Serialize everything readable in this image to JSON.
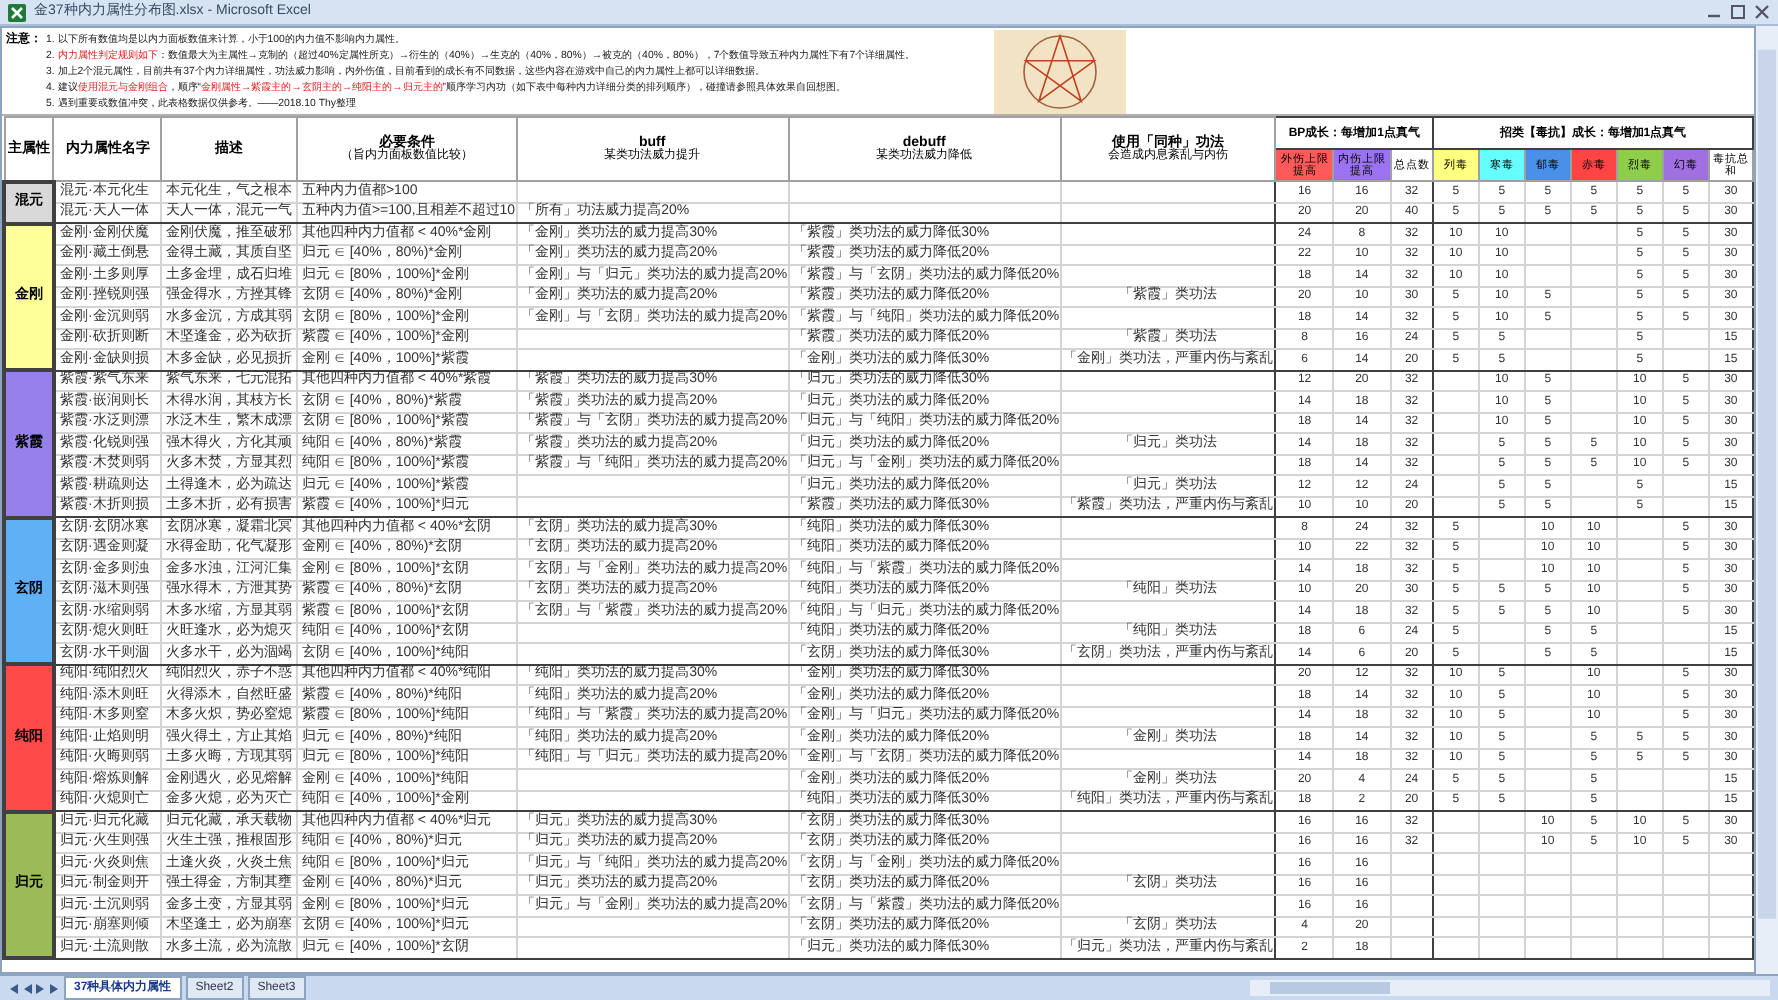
{
  "window": {
    "title": "金37种内力属性分布图.xlsx - Microsoft Excel"
  },
  "notes": {
    "label": "注意：",
    "items": [
      [
        {
          "text": "1. 以下所有数值均是以内力面板数值来计算，小于100的内力值不影响内力属性。",
          "highlight": false
        }
      ],
      [
        {
          "text": "2. ",
          "highlight": false
        },
        {
          "text": "内力属性判定规则如下",
          "highlight": true
        },
        {
          "text": "：数值最大为主属性→克制的（超过40%定属性所克）→衍生的（40%）→生克的（40%，80%）→被克的（40%，80%），7个数值导致五种内力属性下有7个详细属性。",
          "highlight": false
        }
      ],
      [
        {
          "text": "3. 加上2个混元属性，目前共有37个内力详细属性，功法威力影响，内外伤值，目前看到的成长有不同数据，这些内容在游戏中自己的内力属性上都可以详细数据。",
          "highlight": false
        }
      ],
      [
        {
          "text": "4. 建议",
          "highlight": false
        },
        {
          "text": "使用混元与金刚组合",
          "highlight": true
        },
        {
          "text": "，顺序“",
          "highlight": false
        },
        {
          "text": "金刚属性→紫霞主的→玄阴主的→纯阳主的→归元主的",
          "highlight": true
        },
        {
          "text": "”顺序学习内功（如下表中每种内力详细分类的排列顺序），碰撞请参照具体效果自回想图。",
          "highlight": false
        }
      ],
      [
        {
          "text": "5. 遇到重要或数值冲突，此表格数据仅供参考。——2018.10 Thy整理",
          "highlight": false
        }
      ]
    ]
  },
  "table": {
    "columns": [
      {
        "title": "主属性"
      },
      {
        "title": "内力属性名字"
      },
      {
        "title": "描述"
      },
      {
        "title": "必要条件",
        "subtitle": "（旨内力面板数值比较）"
      },
      {
        "title": "buff",
        "subtitle": "某类功法威力提升"
      },
      {
        "title": "debuff",
        "subtitle": "某类功法威力降低"
      },
      {
        "title": "使用「同种」功法",
        "subtitle": "会造成内息紊乱与内伤"
      }
    ],
    "column_groups": [
      {
        "title": "BP成长：每增加1点真气",
        "columns": [
          {
            "label": "外伤上限提高",
            "color": "#ff5a5a"
          },
          {
            "label": "内伤上限提高",
            "color": "#9b72f0"
          },
          {
            "label": "总点数",
            "color": "#ffffff"
          }
        ]
      },
      {
        "title": "招类【毒抗】成长：每增加1点真气",
        "columns": [
          {
            "label": "列毒",
            "color": "#ffff80"
          },
          {
            "label": "寒毒",
            "color": "#66ffff"
          },
          {
            "label": "郁毒",
            "color": "#4a90e8"
          },
          {
            "label": "赤毒",
            "color": "#ff4444"
          },
          {
            "label": "烈毒",
            "color": "#8fce4a"
          },
          {
            "label": "幻毒",
            "color": "#a070e0"
          },
          {
            "label": "毒抗总和",
            "color": "#ffffff"
          }
        ]
      }
    ],
    "groups": [
      {
        "label": "混元",
        "color": "#d9d9d9",
        "rows": [
          {
            "name": "混元·本元化生",
            "description": "本元化生，气之根本",
            "condition": "五种内力值都>100",
            "values": {
              "outer": "16",
              "inner": "16",
              "total": "32",
              "poison_1": "5",
              "poison_2": "5",
              "poison_3": "5",
              "poison_4": "5",
              "poison_5": "5",
              "poison_6": "5",
              "poison_total": "30"
            }
          },
          {
            "name": "混元·天人一体",
            "description": "天人一体，混元一气",
            "condition": "五种内力值>=100,且相差不超过10",
            "buff": "「所有」功法威力提高20%",
            "values": {
              "outer": "20",
              "inner": "20",
              "total": "40",
              "poison_1": "5",
              "poison_2": "5",
              "poison_3": "5",
              "poison_4": "5",
              "poison_5": "5",
              "poison_6": "5",
              "poison_total": "30"
            }
          }
        ]
      },
      {
        "label": "金刚",
        "color": "#ffff99",
        "rows": [
          {
            "name": "金刚·金刚伏魔",
            "description": "金刚伏魔，推至破邪",
            "condition": "其他四种内力值都 < 40%*金刚",
            "buff": "「金刚」类功法的威力提高30%",
            "debuff": "「紫霞」类功法的威力降低30%",
            "values": {
              "outer": "24",
              "inner": "8",
              "total": "32",
              "poison_1": "10",
              "poison_2": "10",
              "poison_5": "5",
              "poison_6": "5",
              "poison_total": "30"
            }
          },
          {
            "name": "金刚·藏土倒悬",
            "description": "金得土藏，其质自坚",
            "condition": "归元 ∈ [40%，80%)*金刚",
            "buff": "「金刚」类功法的威力提高20%",
            "debuff": "「紫霞」类功法的威力降低20%",
            "values": {
              "outer": "22",
              "inner": "10",
              "total": "32",
              "poison_1": "10",
              "poison_2": "10",
              "poison_5": "5",
              "poison_6": "5",
              "poison_total": "30"
            }
          },
          {
            "name": "金刚·土多则厚",
            "description": "土多金埋，成石归堆",
            "condition": "归元 ∈ [80%，100%]*金刚",
            "buff": "「金刚」与「归元」类功法的威力提高20%",
            "debuff": "「紫霞」与「玄阴」类功法的威力降低20%",
            "values": {
              "outer": "18",
              "inner": "14",
              "total": "32",
              "poison_1": "10",
              "poison_2": "10",
              "poison_5": "5",
              "poison_6": "5",
              "poison_total": "30"
            }
          },
          {
            "name": "金刚·挫锐则强",
            "description": "强金得水，方挫其锋",
            "condition": "玄阴 ∈ [40%，80%)*金刚",
            "buff": "「金刚」类功法的威力提高20%",
            "debuff": "「紫霞」类功法的威力降低20%",
            "same_type_use": "「紫霞」类功法",
            "values": {
              "outer": "20",
              "inner": "10",
              "total": "30",
              "poison_1": "5",
              "poison_2": "10",
              "poison_3": "5",
              "poison_5": "5",
              "poison_6": "5",
              "poison_total": "30"
            }
          },
          {
            "name": "金刚·金沉则弱",
            "description": "水多金沉，方成其弱",
            "condition": "玄阴 ∈ [80%，100%]*金刚",
            "buff": "「金刚」与「玄阴」类功法的威力提高20%",
            "debuff": "「紫霞」与「纯阳」类功法的威力降低20%",
            "values": {
              "outer": "18",
              "inner": "14",
              "total": "32",
              "poison_1": "5",
              "poison_2": "10",
              "poison_3": "5",
              "poison_5": "5",
              "poison_6": "5",
              "poison_total": "30"
            }
          },
          {
            "name": "金刚·砍折则断",
            "description": "木坚逢金，必为砍折",
            "condition": "紫霞 ∈ [40%，100%]*金刚",
            "debuff": "「紫霞」类功法的威力降低20%",
            "same_type_use": "「紫霞」类功法",
            "values": {
              "outer": "8",
              "inner": "16",
              "total": "24",
              "poison_1": "5",
              "poison_2": "5",
              "poison_5": "5",
              "poison_total": "15"
            }
          },
          {
            "name": "金刚·金缺则损",
            "description": "木多金缺，必见损折",
            "condition": "金刚 ∈ [40%，100%]*紫霞",
            "debuff": "「金刚」类功法的威力降低30%",
            "same_type_use": "「金刚」类功法，严重内伤与紊乱",
            "values": {
              "outer": "6",
              "inner": "14",
              "total": "20",
              "poison_1": "5",
              "poison_2": "5",
              "poison_5": "5",
              "poison_total": "15"
            }
          }
        ]
      },
      {
        "label": "紫霞",
        "color": "#9580ec",
        "rows": [
          {
            "name": "紫霞·紫气东来",
            "description": "紫气东来，七元混拓",
            "condition": "其他四种内力值都 < 40%*紫霞",
            "buff": "「紫霞」类功法的威力提高30%",
            "debuff": "「归元」类功法的威力降低30%",
            "values": {
              "outer": "12",
              "inner": "20",
              "total": "32",
              "poison_2": "10",
              "poison_3": "5",
              "poison_5": "10",
              "poison_6": "5",
              "poison_total": "30"
            }
          },
          {
            "name": "紫霞·嵌润则长",
            "description": "木得水润，其枝方长",
            "condition": "玄阴 ∈ [40%，80%)*紫霞",
            "buff": "「紫霞」类功法的威力提高20%",
            "debuff": "「归元」类功法的威力降低20%",
            "values": {
              "outer": "14",
              "inner": "18",
              "total": "32",
              "poison_2": "10",
              "poison_3": "5",
              "poison_5": "10",
              "poison_6": "5",
              "poison_total": "30"
            }
          },
          {
            "name": "紫霞·水泛则漂",
            "description": "水泛木生，繁木成漂",
            "condition": "玄阴 ∈ [80%，100%]*紫霞",
            "buff": "「紫霞」与「玄阴」类功法的威力提高20%",
            "debuff": "「归元」与「纯阳」类功法的威力降低20%",
            "values": {
              "outer": "18",
              "inner": "14",
              "total": "32",
              "poison_2": "10",
              "poison_3": "5",
              "poison_5": "10",
              "poison_6": "5",
              "poison_total": "30"
            }
          },
          {
            "name": "紫霞·化锐则强",
            "description": "强木得火，方化其顽",
            "condition": "纯阳 ∈ [40%，80%)*紫霞",
            "buff": "「紫霞」类功法的威力提高20%",
            "debuff": "「归元」类功法的威力降低20%",
            "same_type_use": "「归元」类功法",
            "values": {
              "outer": "14",
              "inner": "18",
              "total": "32",
              "poison_2": "5",
              "poison_3": "5",
              "poison_4": "5",
              "poison_5": "10",
              "poison_6": "5",
              "poison_total": "30"
            }
          },
          {
            "name": "紫霞·木焚则弱",
            "description": "火多木焚，方显其烈",
            "condition": "纯阳 ∈ [80%，100%]*紫霞",
            "buff": "「紫霞」与「纯阳」类功法的威力提高20%",
            "debuff": "「归元」与「金刚」类功法的威力降低20%",
            "values": {
              "outer": "18",
              "inner": "14",
              "total": "32",
              "poison_2": "5",
              "poison_3": "5",
              "poison_4": "5",
              "poison_5": "10",
              "poison_6": "5",
              "poison_total": "30"
            }
          },
          {
            "name": "紫霞·耕疏则达",
            "description": "土得逢木，必为疏达",
            "condition": "归元 ∈ [40%，100%]*紫霞",
            "debuff": "「归元」类功法的威力降低20%",
            "same_type_use": "「归元」类功法",
            "values": {
              "outer": "12",
              "inner": "12",
              "total": "24",
              "poison_2": "5",
              "poison_3": "5",
              "poison_5": "5",
              "poison_total": "15"
            }
          },
          {
            "name": "紫霞·木折则损",
            "description": "土多木折，必有损害",
            "condition": "紫霞 ∈ [40%，100%]*归元",
            "debuff": "「紫霞」类功法的威力降低30%",
            "same_type_use": "「紫霞」类功法，严重内伤与紊乱",
            "values": {
              "outer": "10",
              "inner": "10",
              "total": "20",
              "poison_2": "5",
              "poison_3": "5",
              "poison_5": "5",
              "poison_total": "15"
            }
          }
        ]
      },
      {
        "label": "玄阴",
        "color": "#5fb0f5",
        "rows": [
          {
            "name": "玄阴·玄阴冰寒",
            "description": "玄阴冰寒，凝霜北冥",
            "condition": "其他四种内力值都 < 40%*玄阴",
            "buff": "「玄阴」类功法的威力提高30%",
            "debuff": "「纯阳」类功法的威力降低30%",
            "values": {
              "outer": "8",
              "inner": "24",
              "total": "32",
              "poison_1": "5",
              "poison_3": "10",
              "poison_4": "10",
              "poison_6": "5",
              "poison_total": "30"
            }
          },
          {
            "name": "玄阴·遇金则凝",
            "description": "水得金助，化气凝形",
            "condition": "金刚 ∈ [40%，80%)*玄阴",
            "buff": "「玄阴」类功法的威力提高20%",
            "debuff": "「纯阳」类功法的威力降低20%",
            "values": {
              "outer": "10",
              "inner": "22",
              "total": "32",
              "poison_1": "5",
              "poison_3": "10",
              "poison_4": "10",
              "poison_6": "5",
              "poison_total": "30"
            }
          },
          {
            "name": "玄阴·金多则浊",
            "description": "金多水浊，江河汇集",
            "condition": "金刚 ∈ [80%，100%]*玄阴",
            "buff": "「玄阴」与「金刚」类功法的威力提高20%",
            "debuff": "「纯阳」与「紫霞」类功法的威力降低20%",
            "values": {
              "outer": "14",
              "inner": "18",
              "total": "32",
              "poison_1": "5",
              "poison_3": "10",
              "poison_4": "10",
              "poison_6": "5",
              "poison_total": "30"
            }
          },
          {
            "name": "玄阴·滋木则强",
            "description": "强水得木，方泄其势",
            "condition": "紫霞 ∈ [40%，80%)*玄阴",
            "buff": "「玄阴」类功法的威力提高20%",
            "debuff": "「纯阳」类功法的威力降低20%",
            "same_type_use": "「纯阳」类功法",
            "values": {
              "outer": "10",
              "inner": "20",
              "total": "30",
              "poison_1": "5",
              "poison_2": "5",
              "poison_3": "5",
              "poison_4": "10",
              "poison_6": "5",
              "poison_total": "30"
            }
          },
          {
            "name": "玄阴·水缩则弱",
            "description": "木多水缩，方显其弱",
            "condition": "紫霞 ∈ [80%，100%]*玄阴",
            "buff": "「玄阴」与「紫霞」类功法的威力提高20%",
            "debuff": "「纯阳」与「归元」类功法的威力降低20%",
            "values": {
              "outer": "14",
              "inner": "18",
              "total": "32",
              "poison_1": "5",
              "poison_2": "5",
              "poison_3": "5",
              "poison_4": "10",
              "poison_6": "5",
              "poison_total": "30"
            }
          },
          {
            "name": "玄阴·熄火则旺",
            "description": "火旺逢水，必为熄灭",
            "condition": "纯阳 ∈ [40%，100%]*玄阴",
            "debuff": "「纯阳」类功法的威力降低20%",
            "same_type_use": "「纯阳」类功法",
            "values": {
              "outer": "18",
              "inner": "6",
              "total": "24",
              "poison_1": "5",
              "poison_3": "5",
              "poison_4": "5",
              "poison_total": "15"
            }
          },
          {
            "name": "玄阴·水干则涸",
            "description": "火多水干，必为涸竭",
            "condition": "玄阴 ∈ [40%，100%]*纯阳",
            "debuff": "「玄阴」类功法的威力降低30%",
            "same_type_use": "「玄阴」类功法，严重内伤与紊乱",
            "values": {
              "outer": "14",
              "inner": "6",
              "total": "20",
              "poison_1": "5",
              "poison_3": "5",
              "poison_4": "5",
              "poison_total": "15"
            }
          }
        ]
      },
      {
        "label": "纯阳",
        "color": "#ff4a4a",
        "rows": [
          {
            "name": "纯阳·纯阳烈火",
            "description": "纯阳烈火，赤子不惑",
            "condition": "其他四种内力值都 < 40%*纯阳",
            "buff": "「纯阳」类功法的威力提高30%",
            "debuff": "「金刚」类功法的威力降低30%",
            "values": {
              "outer": "20",
              "inner": "12",
              "total": "32",
              "poison_1": "10",
              "poison_2": "5",
              "poison_4": "10",
              "poison_6": "5",
              "poison_total": "30"
            }
          },
          {
            "name": "纯阳·添木则旺",
            "description": "火得添木，自然旺盛",
            "condition": "紫霞 ∈ [40%，80%)*纯阳",
            "buff": "「纯阳」类功法的威力提高20%",
            "debuff": "「金刚」类功法的威力降低20%",
            "values": {
              "outer": "18",
              "inner": "14",
              "total": "32",
              "poison_1": "10",
              "poison_2": "5",
              "poison_4": "10",
              "poison_6": "5",
              "poison_total": "30"
            }
          },
          {
            "name": "纯阳·木多则窒",
            "description": "木多火炽，势必窒熄",
            "condition": "紫霞 ∈ [80%，100%]*纯阳",
            "buff": "「纯阳」与「紫霞」类功法的威力提高20%",
            "debuff": "「金刚」与「归元」类功法的威力降低20%",
            "values": {
              "outer": "14",
              "inner": "18",
              "total": "32",
              "poison_1": "10",
              "poison_2": "5",
              "poison_4": "10",
              "poison_6": "5",
              "poison_total": "30"
            }
          },
          {
            "name": "纯阳·止焰则明",
            "description": "强火得土，方止其焰",
            "condition": "归元 ∈ [40%，80%)*纯阳",
            "buff": "「纯阳」类功法的威力提高20%",
            "debuff": "「金刚」类功法的威力降低20%",
            "same_type_use": "「金刚」类功法",
            "values": {
              "outer": "18",
              "inner": "14",
              "total": "32",
              "poison_1": "10",
              "poison_2": "5",
              "poison_4": "5",
              "poison_5": "5",
              "poison_6": "5",
              "poison_total": "30"
            }
          },
          {
            "name": "纯阳·火晦则弱",
            "description": "土多火晦，方现其弱",
            "condition": "归元 ∈ [80%，100%]*纯阳",
            "buff": "「纯阳」与「归元」类功法的威力提高20%",
            "debuff": "「金刚」与「玄阴」类功法的威力降低20%",
            "values": {
              "outer": "14",
              "inner": "18",
              "total": "32",
              "poison_1": "10",
              "poison_2": "5",
              "poison_4": "5",
              "poison_5": "5",
              "poison_6": "5",
              "poison_total": "30"
            }
          },
          {
            "name": "纯阳·熔炼则解",
            "description": "金刚遇火，必见熔解",
            "condition": "金刚 ∈ [40%，100%]*纯阳",
            "debuff": "「金刚」类功法的威力降低20%",
            "same_type_use": "「金刚」类功法",
            "values": {
              "outer": "20",
              "inner": "4",
              "total": "24",
              "poison_1": "5",
              "poison_2": "5",
              "poison_4": "5",
              "poison_total": "15"
            }
          },
          {
            "name": "纯阳·火熄则亡",
            "description": "金多火熄，必为灭亡",
            "condition": "纯阳 ∈ [40%，100%]*金刚",
            "debuff": "「纯阳」类功法的威力降低30%",
            "same_type_use": "「纯阳」类功法，严重内伤与紊乱",
            "values": {
              "outer": "18",
              "inner": "2",
              "total": "20",
              "poison_1": "5",
              "poison_2": "5",
              "poison_4": "5",
              "poison_total": "15"
            }
          }
        ]
      },
      {
        "label": "归元",
        "color": "#9bbb59",
        "rows": [
          {
            "name": "归元·归元化藏",
            "description": "归元化藏，承天载物",
            "condition": "其他四种内力值都 < 40%*归元",
            "buff": "「归元」类功法的威力提高30%",
            "debuff": "「玄阴」类功法的威力降低30%",
            "values": {
              "outer": "16",
              "inner": "16",
              "total": "32",
              "poison_3": "10",
              "poison_4": "5",
              "poison_5": "10",
              "poison_6": "5",
              "poison_total": "30"
            }
          },
          {
            "name": "归元·火生则强",
            "description": "火生土强，推根固形",
            "condition": "纯阳 ∈ [40%，80%)*归元",
            "buff": "「归元」类功法的威力提高20%",
            "debuff": "「玄阴」类功法的威力降低20%",
            "values": {
              "outer": "16",
              "inner": "16",
              "total": "32",
              "poison_3": "10",
              "poison_4": "5",
              "poison_5": "10",
              "poison_6": "5",
              "poison_total": "30"
            }
          },
          {
            "name": "归元·火炎则焦",
            "description": "土逢火炎，火炎土焦",
            "condition": "纯阳 ∈ [80%，100%]*归元",
            "buff": "「归元」与「纯阳」类功法的威力提高20%",
            "debuff": "「玄阴」与「金刚」类功法的威力降低20%",
            "values": {
              "outer": "16",
              "inner": "16"
            }
          },
          {
            "name": "归元·制金则开",
            "description": "强土得金，方制其壅",
            "condition": "金刚 ∈ [40%，80%)*归元",
            "buff": "「归元」类功法的威力提高20%",
            "debuff": "「玄阴」类功法的威力降低20%",
            "same_type_use": "「玄阴」类功法",
            "values": {
              "outer": "16",
              "inner": "16"
            }
          },
          {
            "name": "归元·土沉则弱",
            "description": "金多土变，方显其弱",
            "condition": "金刚 ∈ [80%，100%]*归元",
            "buff": "「归元」与「金刚」类功法的威力提高20%",
            "debuff": "「玄阴」与「紫霞」类功法的威力降低20%",
            "values": {
              "outer": "16",
              "inner": "16"
            }
          },
          {
            "name": "归元·崩塞则倾",
            "description": "木坚逢土，必为崩塞",
            "condition": "玄阴 ∈ [40%，100%]*归元",
            "debuff": "「玄阴」类功法的威力降低20%",
            "same_type_use": "「玄阴」类功法",
            "values": {
              "outer": "4",
              "inner": "20"
            }
          },
          {
            "name": "归元·土流则散",
            "description": "水多土流，必为流散",
            "condition": "归元 ∈ [40%，100%]*玄阴",
            "debuff": "「归元」类功法的威力降低30%",
            "same_type_use": "「归元」类功法，严重内伤与紊乱",
            "values": {
              "outer": "2",
              "inner": "18"
            }
          }
        ]
      }
    ]
  },
  "sheet_tabs": [
    {
      "label": "37种具体内力属性",
      "selected": true
    },
    {
      "label": "Sheet2",
      "selected": false
    },
    {
      "label": "Sheet3",
      "selected": false
    }
  ]
}
